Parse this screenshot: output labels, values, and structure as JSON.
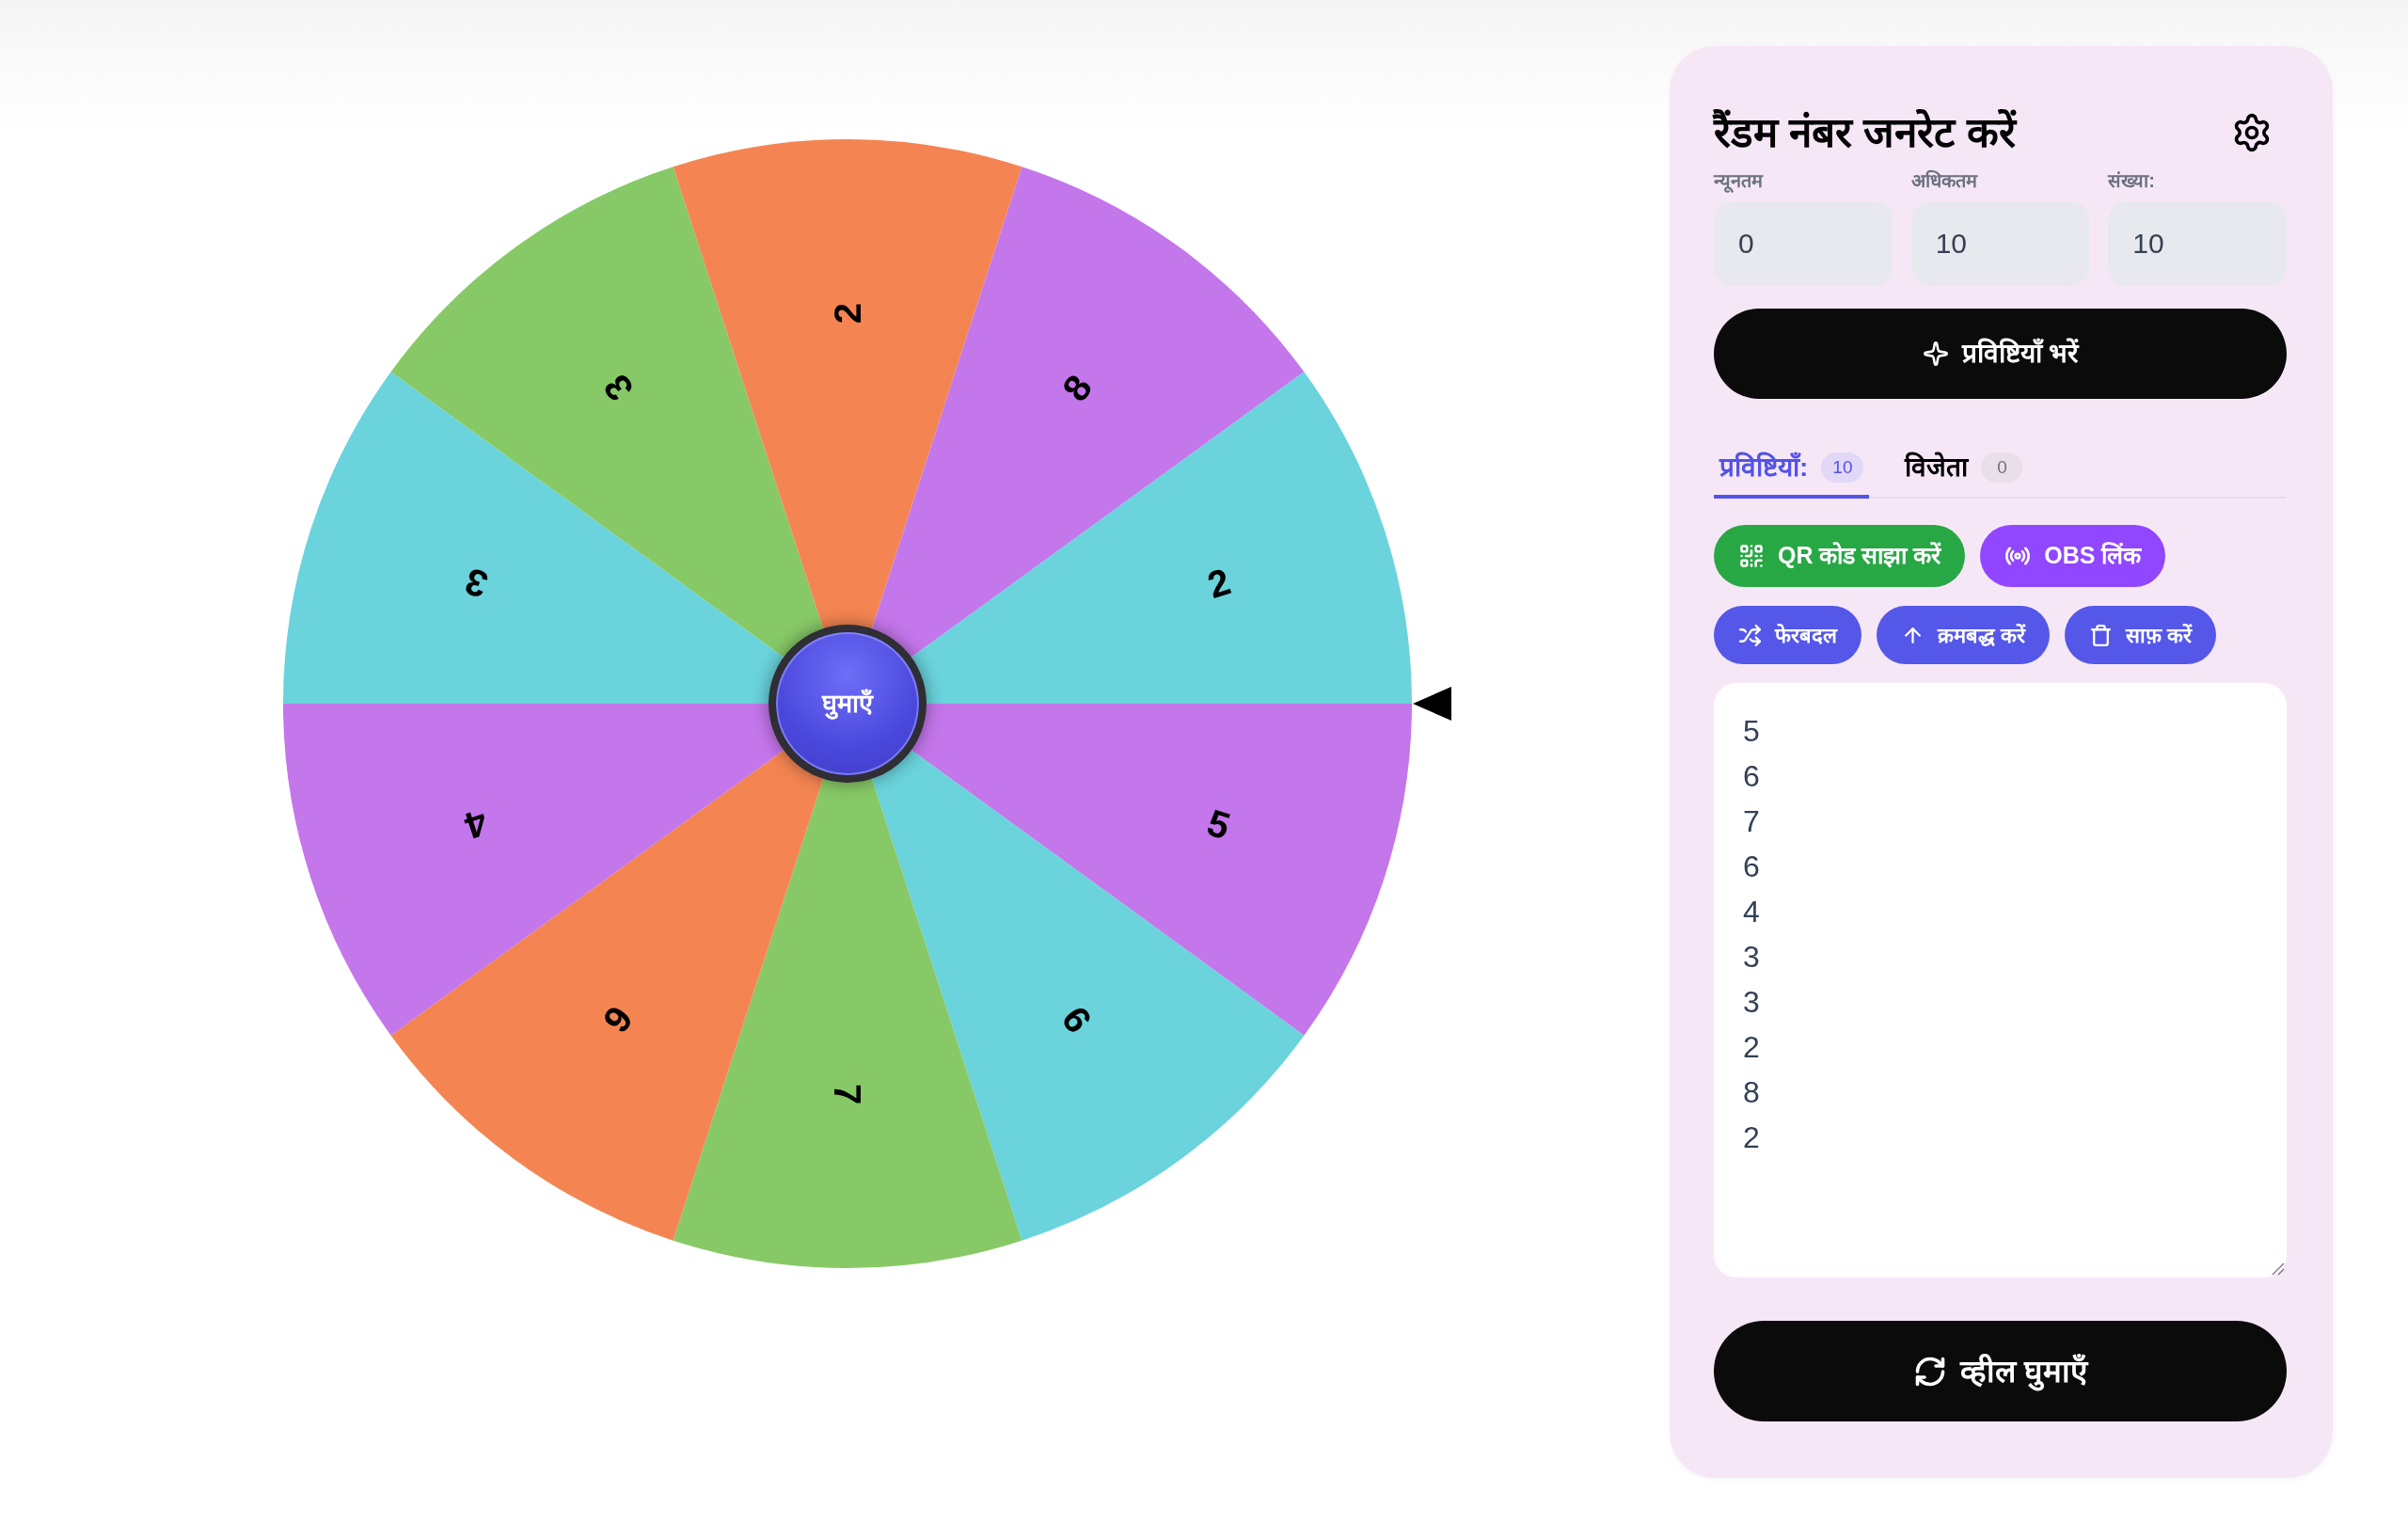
{
  "wheel": {
    "segments": [
      {
        "label": "5",
        "color": "#c476eb"
      },
      {
        "label": "6",
        "color": "#6ad3dc"
      },
      {
        "label": "7",
        "color": "#87c967"
      },
      {
        "label": "6",
        "color": "#f48552"
      },
      {
        "label": "4",
        "color": "#c476eb"
      },
      {
        "label": "3",
        "color": "#6ad3dc"
      },
      {
        "label": "3",
        "color": "#87c967"
      },
      {
        "label": "2",
        "color": "#f48552"
      },
      {
        "label": "8",
        "color": "#c476eb"
      },
      {
        "label": "2",
        "color": "#6ad3dc"
      }
    ],
    "center_button": "घुमाएँ"
  },
  "panel": {
    "title": "रैंडम नंबर जनरेट करें",
    "fields": [
      {
        "label": "न्यूनतम",
        "value": "0"
      },
      {
        "label": "अधिकतम",
        "value": "10"
      },
      {
        "label": "संख्या:",
        "value": "10"
      }
    ],
    "fill_button": "प्रविष्टियाँ भरें",
    "tabs": [
      {
        "label": "प्रविष्टियाँ:",
        "count": "10",
        "selected": true
      },
      {
        "label": "विजेता",
        "count": "0",
        "selected": false
      }
    ],
    "share_buttons": [
      {
        "label": "QR कोड साझा करें",
        "kind": "qr"
      },
      {
        "label": "OBS लिंक",
        "kind": "obs"
      }
    ],
    "action_buttons": [
      {
        "label": "फेरबदल",
        "kind": "shuffle"
      },
      {
        "label": "क्रमबद्ध करें",
        "kind": "sort"
      },
      {
        "label": "साफ़ करें",
        "kind": "clear"
      }
    ],
    "entries": [
      "5",
      "6",
      "7",
      "6",
      "4",
      "3",
      "3",
      "2",
      "8",
      "2"
    ],
    "spin_button": "व्हील घुमाएँ"
  }
}
